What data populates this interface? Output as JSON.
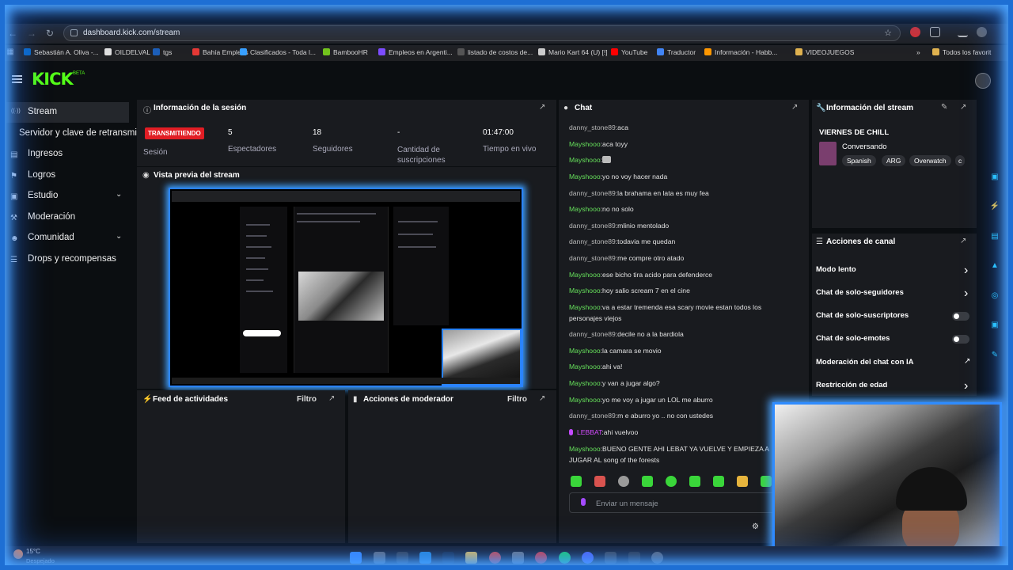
{
  "browser": {
    "url": "dashboard.kick.com/stream",
    "bookmarks": [
      {
        "label": "Sebastián A. Oliva -...",
        "icon": "linkedin-icon",
        "color": "#0a66c2"
      },
      {
        "label": "OILDELVAL",
        "icon": "grid-icon",
        "color": "#e0e0e0"
      },
      {
        "label": "tgs",
        "icon": "tgs-icon",
        "color": "#1d5fb8"
      },
      {
        "label": "Bahía Empleos",
        "icon": "pin-icon",
        "color": "#e53935"
      },
      {
        "label": "Clasificados - Toda l...",
        "icon": "bookmark-icon",
        "color": "#39a0ff"
      },
      {
        "label": "BambooHR",
        "icon": "bamboo-icon",
        "color": "#73c41d"
      },
      {
        "label": "Empleos en Argenti...",
        "icon": "arrow-icon",
        "color": "#7d4cff"
      },
      {
        "label": "listado de costos de...",
        "icon": "doc-icon",
        "color": "#555"
      },
      {
        "label": "Mario Kart 64 (U) [!]",
        "icon": "kart-icon",
        "color": "#ccc"
      },
      {
        "label": "YouTube",
        "icon": "youtube-icon",
        "color": "#ff0000"
      },
      {
        "label": "Traductor",
        "icon": "translate-icon",
        "color": "#4285f4"
      },
      {
        "label": "Información - Habb...",
        "icon": "habbo-icon",
        "color": "#ff9800"
      },
      {
        "label": "VIDEOJUEGOS",
        "icon": "folder-icon",
        "color": "#e0b24f"
      },
      {
        "label": "Todos los favorit",
        "icon": "folder-icon",
        "color": "#e0b24f"
      }
    ]
  },
  "kick": {
    "logo": "KICK",
    "beta": "BETA"
  },
  "sidebar": {
    "items": [
      {
        "label": "Stream",
        "icon": "broadcast-icon",
        "active": true
      },
      {
        "label": "Servidor y clave de retransmisión",
        "icon": "",
        "active": false
      },
      {
        "label": "Ingresos",
        "icon": "money-icon",
        "active": false
      },
      {
        "label": "Logros",
        "icon": "trophy-icon",
        "active": false
      },
      {
        "label": "Estudio",
        "icon": "studio-icon",
        "active": false,
        "expandable": true
      },
      {
        "label": "Moderación",
        "icon": "wrench-icon",
        "active": false
      },
      {
        "label": "Comunidad",
        "icon": "people-icon",
        "active": false,
        "expandable": true
      },
      {
        "label": "Drops y recompensas",
        "icon": "gift-icon",
        "active": false
      }
    ]
  },
  "session": {
    "title": "Información de la sesión",
    "status_badge": "TRANSMITIENDO",
    "status_label": "Sesión",
    "viewers_value": "5",
    "viewers_label": "Espectadores",
    "followers_value": "18",
    "followers_label": "Seguidores",
    "subs_value": "-",
    "subs_label": "Cantidad de suscripciones",
    "time_value": "01:47:00",
    "time_label": "Tiempo en vivo"
  },
  "preview": {
    "title": "Vista previa del stream"
  },
  "activity": {
    "title": "Feed de actividades",
    "filter": "Filtro"
  },
  "modactions": {
    "title": "Acciones de moderador",
    "filter": "Filtro"
  },
  "chat": {
    "title": "Chat",
    "messages": [
      {
        "user": "danny_stone89",
        "text": "aca",
        "cls": "dan"
      },
      {
        "user": "Mayshooo",
        "text": "aca toyy",
        "cls": "may"
      },
      {
        "user": "Mayshooo",
        "text": "",
        "cls": "may",
        "emote": true
      },
      {
        "user": "Mayshooo",
        "text": "yo no voy hacer nada",
        "cls": "may"
      },
      {
        "user": "danny_stone89",
        "text": "la brahama en lata es muy fea",
        "cls": "dan"
      },
      {
        "user": "Mayshooo",
        "text": "no no solo",
        "cls": "may"
      },
      {
        "user": "danny_stone89",
        "text": "mlinio mentolado",
        "cls": "dan"
      },
      {
        "user": "danny_stone89",
        "text": "todavia me quedan",
        "cls": "dan"
      },
      {
        "user": "danny_stone89",
        "text": "me compre otro atado",
        "cls": "dan"
      },
      {
        "user": "Mayshooo",
        "text": "ese bicho tira acido para defenderce",
        "cls": "may"
      },
      {
        "user": "Mayshooo",
        "text": "hoy salio scream 7 en el cine",
        "cls": "may"
      },
      {
        "user": "Mayshooo",
        "text": "va a estar tremenda esa scary movie estan todos los personajes viejos",
        "cls": "may"
      },
      {
        "user": "danny_stone89",
        "text": "decile no a la bardiola",
        "cls": "dan"
      },
      {
        "user": "Mayshooo",
        "text": "la camara se movio",
        "cls": "may"
      },
      {
        "user": "Mayshooo",
        "text": "ahi va!",
        "cls": "may"
      },
      {
        "user": "Mayshooo",
        "text": "y van a jugar algo?",
        "cls": "may"
      },
      {
        "user": "Mayshooo",
        "text": "yo me voy a jugar un LOL me aburro",
        "cls": "may"
      },
      {
        "user": "danny_stone89",
        "text": "m e aburro yo .. no con ustedes",
        "cls": "dan"
      },
      {
        "user": "LEBBAT",
        "text": "ahi vuelvoo",
        "cls": "leb"
      },
      {
        "user": "Mayshooo",
        "text": "BUENO GENTE AHI LEBAT YA VUELVE Y EMPIEZA A JUGAR AL song of the forests",
        "cls": "may"
      }
    ],
    "input_placeholder": "Enviar un mensaje"
  },
  "stream_info": {
    "title": "Información del stream",
    "stream_title": "VIERNES DE CHILL",
    "category": "Conversando",
    "tags": [
      "Spanish",
      "ARG",
      "Overwatch",
      "c"
    ]
  },
  "channel_actions": {
    "title": "Acciones de canal",
    "items": [
      {
        "label": "Modo lento",
        "control": "arrow"
      },
      {
        "label": "Chat de solo-seguidores",
        "control": "arrow"
      },
      {
        "label": "Chat de solo-suscriptores",
        "control": "toggle"
      },
      {
        "label": "Chat de solo-emotes",
        "control": "toggle"
      },
      {
        "label": "Moderación del chat con IA",
        "control": "external"
      },
      {
        "label": "Restricción de edad",
        "control": "arrow"
      }
    ]
  },
  "taskbar": {
    "temp": "15°C",
    "weather": "Despejado"
  }
}
